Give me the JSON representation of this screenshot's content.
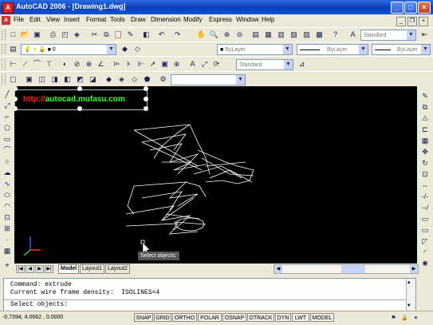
{
  "window": {
    "title": "AutoCAD 2006 - [Drawing1.dwg]",
    "app_icon": "A"
  },
  "menu": [
    "File",
    "Edit",
    "View",
    "Insert",
    "Format",
    "Tools",
    "Draw",
    "Dimension",
    "Modify",
    "Express",
    "Window",
    "Help"
  ],
  "toolbar": {
    "text_style": "Standard",
    "layer": "0",
    "color": "ByLayer",
    "linetype": "ByLayer",
    "lineweight": "ByLayer",
    "dim_style": "Standard"
  },
  "canvas": {
    "watermark_prefix": "http://",
    "watermark_site": "autocad.mufasu.com",
    "tooltip": "Select objects:"
  },
  "tabs": [
    "Model",
    "Layout1",
    "Layout2"
  ],
  "command": {
    "lines": [
      "Command: extrude",
      "Current wire frame density:  ISOLINES=4"
    ],
    "prompt": "Select objects:"
  },
  "status": {
    "coords": "-0.7394, 4.0662 , 0.0000",
    "buttons": [
      "SNAP",
      "GRID",
      "ORTHO",
      "POLAR",
      "OSNAP",
      "OTRACK",
      "DYN",
      "LWT",
      "MODEL"
    ]
  },
  "colors": {
    "watermark_prefix": "#ff2020",
    "watermark_site": "#30ff30",
    "titlebar": "#0a3fb8",
    "canvas": "#000000"
  }
}
